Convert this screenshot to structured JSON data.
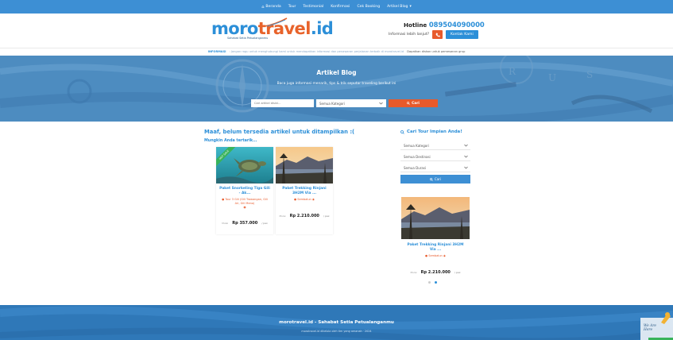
{
  "nav": {
    "items": [
      "Beranda",
      "Tour",
      "Testimonial",
      "Konfirmasi",
      "Cek Booking",
      "Artikel Blog"
    ],
    "blog_chevron": "▾"
  },
  "header": {
    "logo_moro": "moro",
    "logo_travel": "travel",
    "logo_id": ".id",
    "logo_tagline": "Sahabat Setia Petualanganmu",
    "hotline_label": "Hotline",
    "hotline_number": "089504090000",
    "info_text": "Informasi lebih lanjut?",
    "contact_label": "Kontak Kami"
  },
  "ticker": {
    "label": "INFORMASI",
    "message": ": Jangan ragu untuk menghubungi kami untuk mendapatkan informasi dan penawaran perjalanan terbaik di morotravel.id",
    "message2": "Dapatkan diskon untuk pemesanan grup"
  },
  "hero": {
    "title": "Artikel Blog",
    "subtitle": "Baca juga informasi menarik, tips & trik seputar traveling berikut ini",
    "search_placeholder": "Cari artikel disini...",
    "category_select": "Semua Kategori",
    "search_button": "Cari"
  },
  "content": {
    "empty_message": "Maaf, belum tersedia artikel untuk ditampilkan :(",
    "suggest_label": "Mungkin Anda tertarik...",
    "cards": [
      {
        "title": "Paket Snorkeling Tiga Gili - Ak...",
        "location": "Tour 3 Gili (Gili Trawangan, Gili Air, Gili Meno)",
        "ribbon": "HOT SALE",
        "price_from": "Mulai",
        "price": "Rp 357.000",
        "per": "/ pax"
      },
      {
        "title": "Paket Trekking Rinjani 3H2M Via ...",
        "location": "Sembalun",
        "ribbon": "",
        "price_from": "Mulai",
        "price": "Rp 2.210.000",
        "per": "/ pax"
      }
    ]
  },
  "sidebar": {
    "title": "Cari Tour Impian Anda!",
    "selects": [
      "Semua Kategori",
      "Semua Destinasi",
      "Semua Durasi"
    ],
    "search_button": "Cari",
    "featured": {
      "title": "Paket Trekking Rinjani 3H2M Via ...",
      "location": "Sembalun",
      "price_from": "Mulai",
      "price": "Rp 2.210.000",
      "per": "/ pax"
    }
  },
  "footer": {
    "title": "morotravel.id - Sahabat Setia Petualanganmu",
    "subtitle": "morotravel.id dikelola oleh tim yang amanah · 2024",
    "chat_line1": "We Are",
    "chat_line2": "Here"
  },
  "colors": {
    "brand_blue": "#2c8fd8",
    "brand_orange": "#e85a2b",
    "nav_blue": "#3d8fd4",
    "footer_blue": "#2f78b8",
    "hot_green": "#38b35a"
  },
  "icons": {
    "home": "home-icon",
    "phone": "phone-icon",
    "search": "search-icon",
    "chevron": "chevron-down-icon",
    "location": "location-pin-icon"
  }
}
